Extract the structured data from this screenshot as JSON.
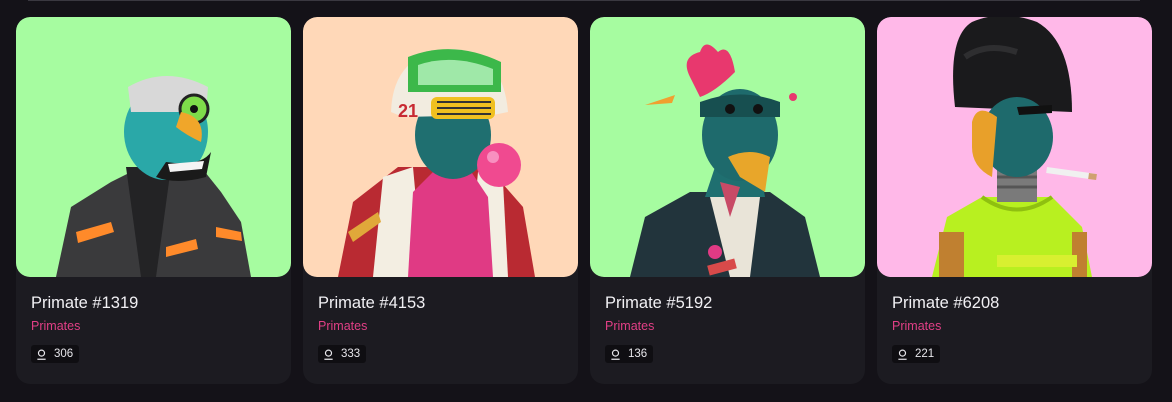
{
  "cards": [
    {
      "title": "Primate #1319",
      "collection": "Primates",
      "count": "306",
      "bg": "#a6fca0",
      "icon": "user-icon"
    },
    {
      "title": "Primate #4153",
      "collection": "Primates",
      "count": "333",
      "bg": "#ffd8b8",
      "icon": "user-icon"
    },
    {
      "title": "Primate #5192",
      "collection": "Primates",
      "count": "136",
      "bg": "#a6fca0",
      "icon": "user-icon"
    },
    {
      "title": "Primate #6208",
      "collection": "Primates",
      "count": "221",
      "bg": "#ffb8e8",
      "icon": "user-icon"
    }
  ],
  "colors": {
    "accent": "#e23f86",
    "page_bg": "#141218",
    "card_bg": "#1c1b21"
  }
}
